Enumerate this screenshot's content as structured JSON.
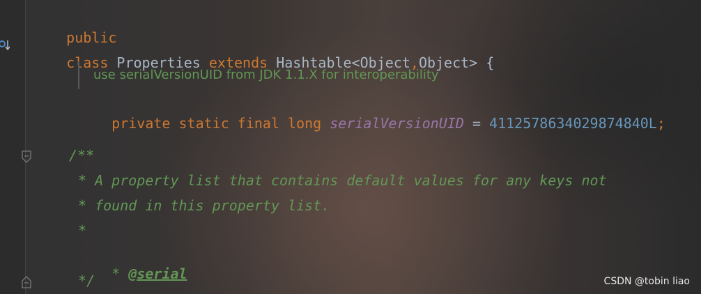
{
  "editor": {
    "lines": {
      "l1": {
        "kw": "public"
      },
      "l2": {
        "kw_class": "class",
        "name": " Properties ",
        "kw_extends": "extends",
        "rest": " Hashtable<Object",
        "comma": ",",
        "rest2": "Object> {"
      },
      "inlay_comment": "use serialVersionUID from JDK 1.1.X for interoperability",
      "l4": {
        "kw": "private static final long",
        "field": "serialVersionUID",
        "eq": " = ",
        "num": "4112578634029874840L",
        "semi": ";"
      },
      "l6": "/**",
      "l7": "* A property list that contains default values for any keys not",
      "l8": "* found in this property list.",
      "l9": "*",
      "l10_star": "* ",
      "l10_tag": "@serial",
      "l11": "*/"
    },
    "colors": {
      "keyword": "#cc7832",
      "plain": "#a9b7c6",
      "field": "#9876aa",
      "number": "#6897bb",
      "doc_comment": "#629755"
    },
    "gutter_icons": [
      "implementation-marker-icon",
      "fold-start-icon",
      "fold-end-icon"
    ]
  },
  "watermark": "CSDN @tobin liao"
}
